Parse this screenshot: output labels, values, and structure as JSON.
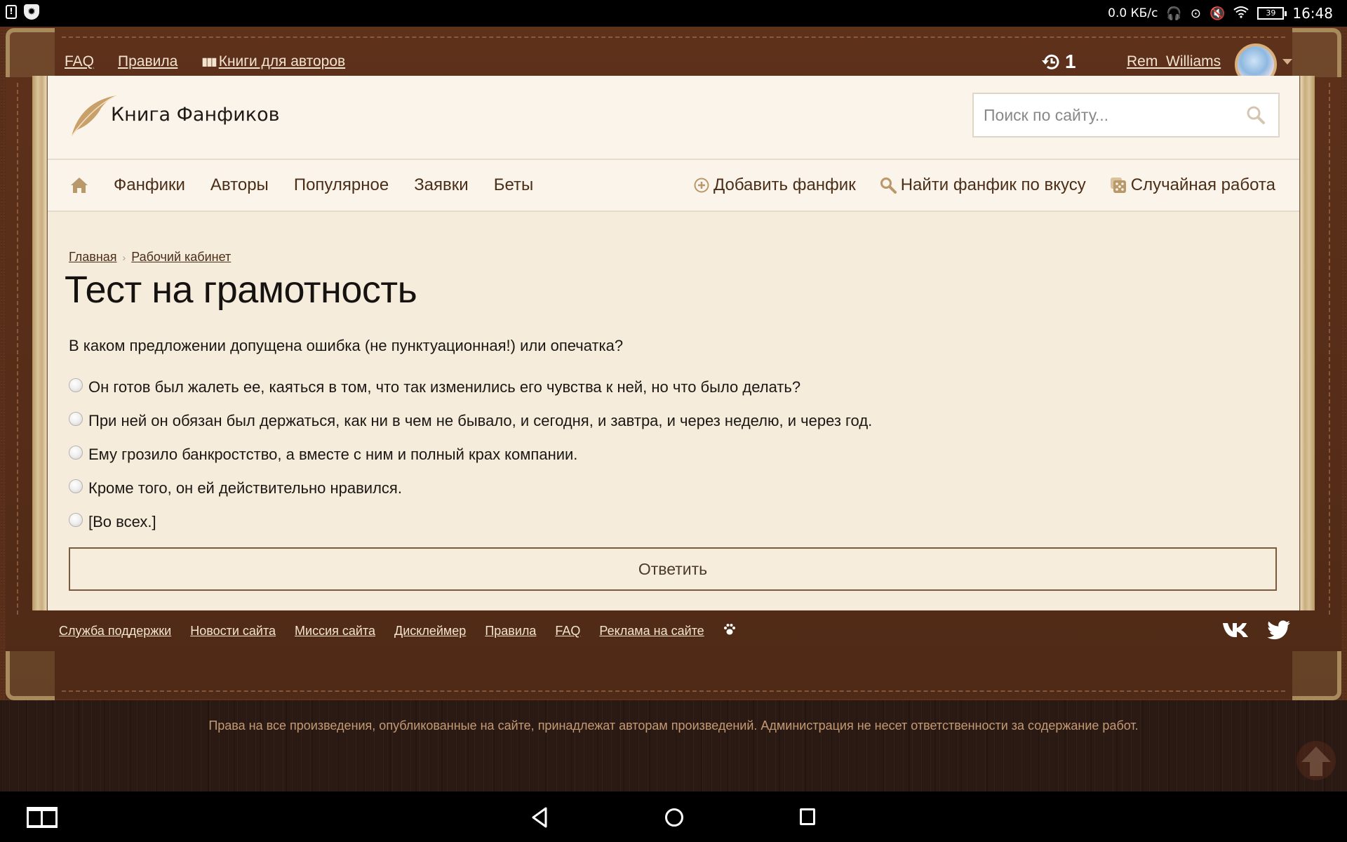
{
  "statusbar": {
    "net_speed": "0.0 КБ/с",
    "battery": "39",
    "time": "16:48",
    "left_icons": [
      "alert-icon",
      "antivirus-shield-icon"
    ],
    "right_icons": [
      "headset-icon",
      "screen-record-icon",
      "mute-icon",
      "wifi-icon",
      "battery-icon"
    ]
  },
  "topbar": {
    "links": [
      {
        "label": "FAQ"
      },
      {
        "label": "Правила"
      },
      {
        "label": "Книги для авторов",
        "icon": "books-icon"
      }
    ],
    "history_count": "1",
    "username": "Rem_Williams"
  },
  "header": {
    "site_name": "Книга Фанфиков",
    "search_placeholder": "Поиск по сайту..."
  },
  "nav": {
    "left": [
      {
        "label": "Фанфики"
      },
      {
        "label": "Авторы"
      },
      {
        "label": "Популярное"
      },
      {
        "label": "Заявки"
      },
      {
        "label": "Беты"
      }
    ],
    "right": [
      {
        "label": "Добавить фанфик",
        "icon": "plus-circle-icon"
      },
      {
        "label": "Найти фанфик по вкусу",
        "icon": "search-icon"
      },
      {
        "label": "Случайная работа",
        "icon": "dice-icon"
      }
    ]
  },
  "breadcrumb": [
    {
      "label": "Главная"
    },
    {
      "label": "Рабочий кабинет"
    }
  ],
  "breadcrumb_separator": "›",
  "page_title": "Тест на грамотность",
  "quiz": {
    "question": "В каком предложении допущена ошибка (не пунктуационная!) или опечатка?",
    "options": [
      {
        "label": "Он готов был жалеть ее, каяться в том, что так изменились его чувства к ней, но что было делать?",
        "selected": false
      },
      {
        "label": "При ней он обязан был держаться, как ни в чем не бывало, и сегодня, и завтра, и через неделю, и через год.",
        "selected": false
      },
      {
        "label": "Ему грозило банкростство, а вместе с ним и полный крах компании.",
        "selected": false
      },
      {
        "label": "Кроме того, он ей действительно нравился.",
        "selected": false
      },
      {
        "label": "[Во всех.]",
        "selected": false
      }
    ],
    "submit_label": "Ответить"
  },
  "footer": {
    "links": [
      {
        "label": "Служба поддержки"
      },
      {
        "label": "Новости сайта"
      },
      {
        "label": "Миссия сайта"
      },
      {
        "label": "Дисклеймер"
      },
      {
        "label": "Правила"
      },
      {
        "label": "FAQ"
      },
      {
        "label": "Реклама на сайте"
      }
    ],
    "social": [
      "vk-icon",
      "twitter-icon"
    ],
    "copyright": "Права на все произведения, опубликованные на сайте, принадлежат авторам произведений. Администрация не несет ответственности за содержание работ."
  },
  "colors": {
    "leather": "#5a2f1a",
    "paper": "#f6ecdc",
    "header_bg": "#fbf4ea",
    "accent_gold": "#b9986a",
    "text_brown": "#4a2e18",
    "username": "#d5a878"
  }
}
